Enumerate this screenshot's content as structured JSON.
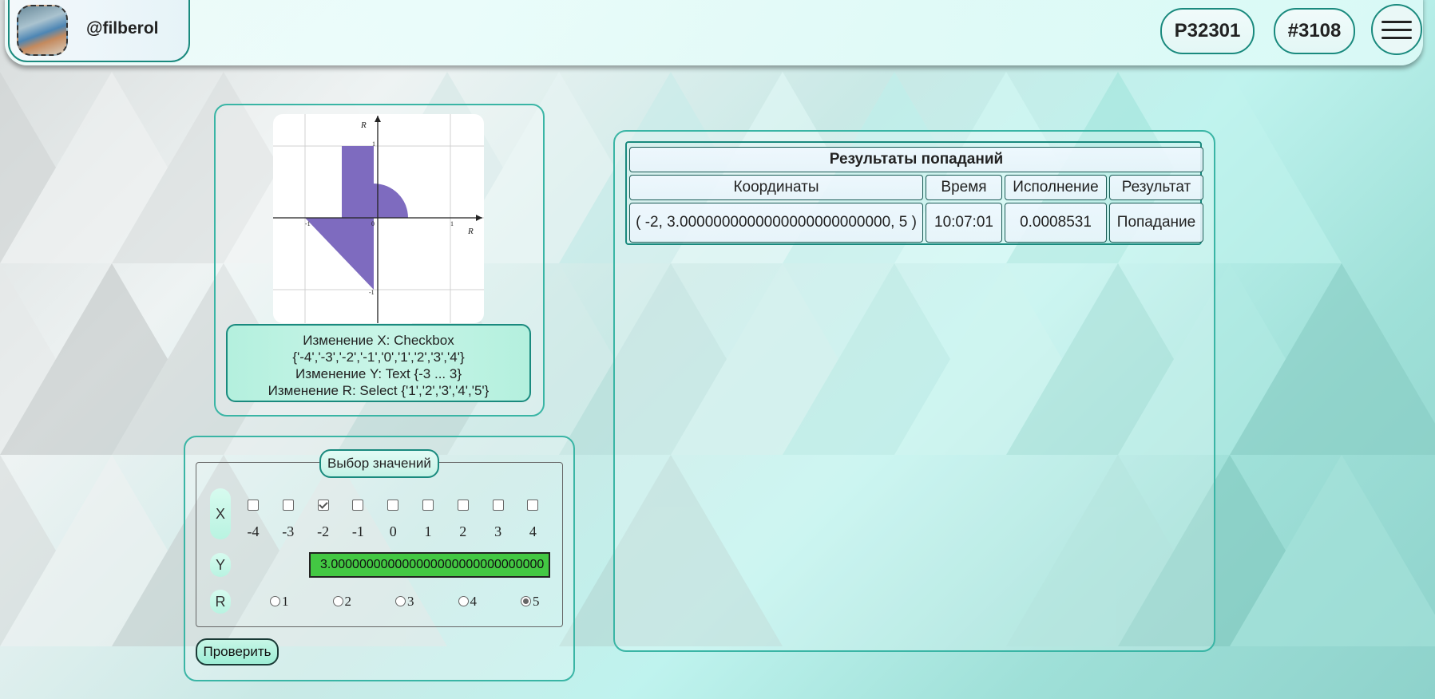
{
  "header": {
    "username": "@filberol",
    "group": "P32301",
    "variant": "#3108",
    "menu_icon": "hamburger-menu-icon"
  },
  "graph": {
    "label_r_top": "R",
    "label_r_right": "R",
    "tick_1_top": "1",
    "tick_1_right": "1",
    "tick_neg1_left": "-1",
    "tick_neg1_bottom": "-1",
    "origin": "0",
    "area_color": "#7e6bbf"
  },
  "info": {
    "line1": "Изменение X: Checkbox",
    "line2": "{'-4','-3','-2','-1','0','1','2','3','4'}",
    "line3": "Изменение Y: Text {-3 ... 3}",
    "line4": "Изменение R: Select {'1','2','3','4','5'}"
  },
  "form": {
    "legend": "Выбор значений",
    "x_label": "X",
    "y_label": "Y",
    "r_label": "R",
    "x_options": [
      {
        "label": "-4",
        "checked": false
      },
      {
        "label": "-3",
        "checked": false
      },
      {
        "label": "-2",
        "checked": true
      },
      {
        "label": "-1",
        "checked": false
      },
      {
        "label": "0",
        "checked": false
      },
      {
        "label": "1",
        "checked": false
      },
      {
        "label": "2",
        "checked": false
      },
      {
        "label": "3",
        "checked": false
      },
      {
        "label": "4",
        "checked": false
      }
    ],
    "y_value": "3.000000000000000000000000000000",
    "r_options": [
      {
        "label": "1",
        "checked": false
      },
      {
        "label": "2",
        "checked": false
      },
      {
        "label": "3",
        "checked": false
      },
      {
        "label": "4",
        "checked": false
      },
      {
        "label": "5",
        "checked": true
      }
    ],
    "submit_label": "Проверить"
  },
  "results": {
    "title": "Результаты попаданий",
    "headers": [
      "Координаты",
      "Время",
      "Исполнение",
      "Результат"
    ],
    "rows": [
      [
        "( -2, 3.0000000000000000000000000, 5 )",
        "10:07:01",
        "0.0008531",
        "Попадание"
      ]
    ]
  }
}
